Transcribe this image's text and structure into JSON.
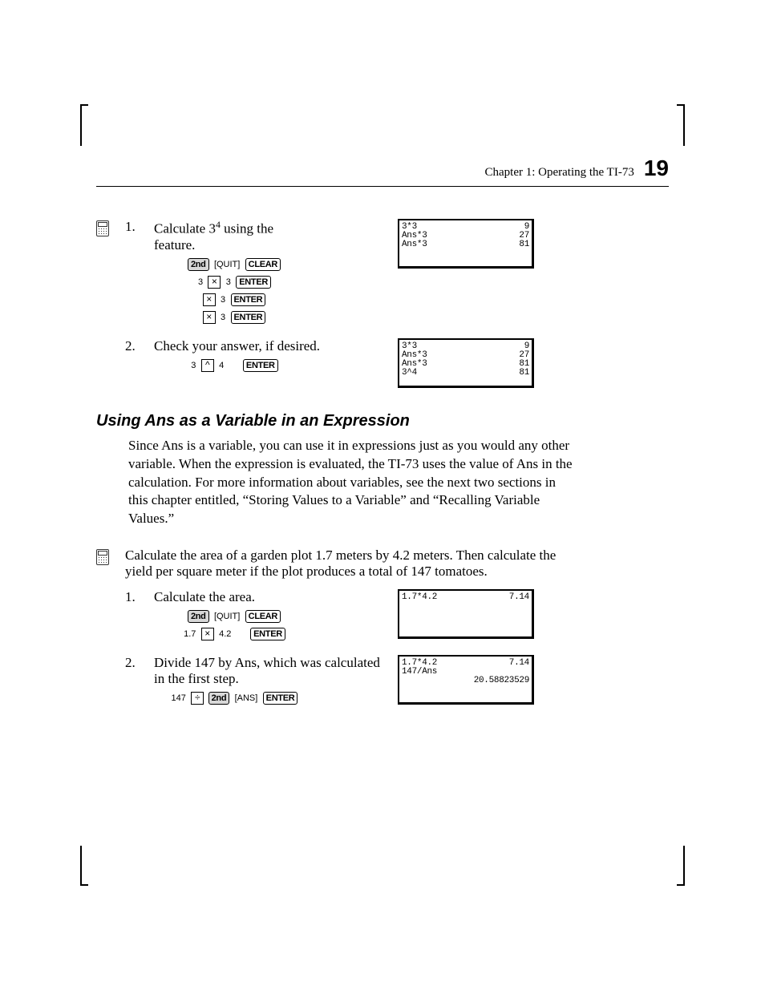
{
  "header": {
    "chapter": "Chapter 1: Operating the TI-73",
    "page": "19"
  },
  "ex1": {
    "step1": {
      "num": "1.",
      "text_a": "Calculate 3",
      "text_sup": "4",
      "text_b": " using the ",
      "text_c": "feature.",
      "keys": {
        "r1": {
          "k2nd": "2nd",
          "quit": "[QUIT]",
          "clear": "CLEAR"
        },
        "r2": {
          "pre": "3",
          "x": "×",
          "post": "3",
          "enter": "ENTER"
        },
        "r3": {
          "x": "×",
          "post": "3",
          "enter": "ENTER"
        },
        "r4": {
          "x": "×",
          "post": "3",
          "enter": "ENTER"
        }
      },
      "screen": [
        {
          "l": "3*3",
          "r": "9"
        },
        {
          "l": "Ans*3",
          "r": "27"
        },
        {
          "l": "Ans*3",
          "r": "81"
        }
      ]
    },
    "step2": {
      "num": "2.",
      "text": "Check your answer, if desired.",
      "keys": {
        "pre": "3",
        "caret": "^",
        "post": "4",
        "enter": "ENTER"
      },
      "screen": [
        {
          "l": "3*3",
          "r": "9"
        },
        {
          "l": "Ans*3",
          "r": "27"
        },
        {
          "l": "Ans*3",
          "r": "81"
        },
        {
          "l": "3^4",
          "r": "81"
        }
      ]
    }
  },
  "sec": {
    "heading": "Using Ans as a Variable in an Expression",
    "para": "Since Ans is a variable, you can use it in expressions just as you would any other variable. When the expression is evaluated, the TI-73 uses the value of Ans in the calculation. For more information about variables, see the next two sections in this chapter entitled, “Storing Values to a Variable” and “Recalling Variable Values.”"
  },
  "ex2": {
    "intro": "Calculate the area of a garden plot 1.7 meters by 4.2 meters. Then calculate the yield per square meter if the plot produces a total of 147 tomatoes.",
    "step1": {
      "num": "1.",
      "text": "Calculate the area.",
      "keys": {
        "r1": {
          "k2nd": "2nd",
          "quit": "[QUIT]",
          "clear": "CLEAR"
        },
        "r2": {
          "pre": "1.7",
          "x": "×",
          "post": "4.2",
          "enter": "ENTER"
        }
      },
      "screen": [
        {
          "l": "1.7*4.2",
          "r": "7.14"
        }
      ]
    },
    "step2": {
      "num": "2.",
      "text_a": "Divide 147 by ",
      "text_b": ", which was calculated in the first step.",
      "keys": {
        "pre": "147",
        "div": "÷",
        "k2nd": "2nd",
        "ans": "[ANS]",
        "enter": "ENTER"
      },
      "screen": [
        {
          "l": "1.7*4.2",
          "r": "7.14"
        },
        {
          "l": "147/Ans",
          "r": ""
        },
        {
          "l": "",
          "r": "20.58823529"
        }
      ]
    }
  }
}
